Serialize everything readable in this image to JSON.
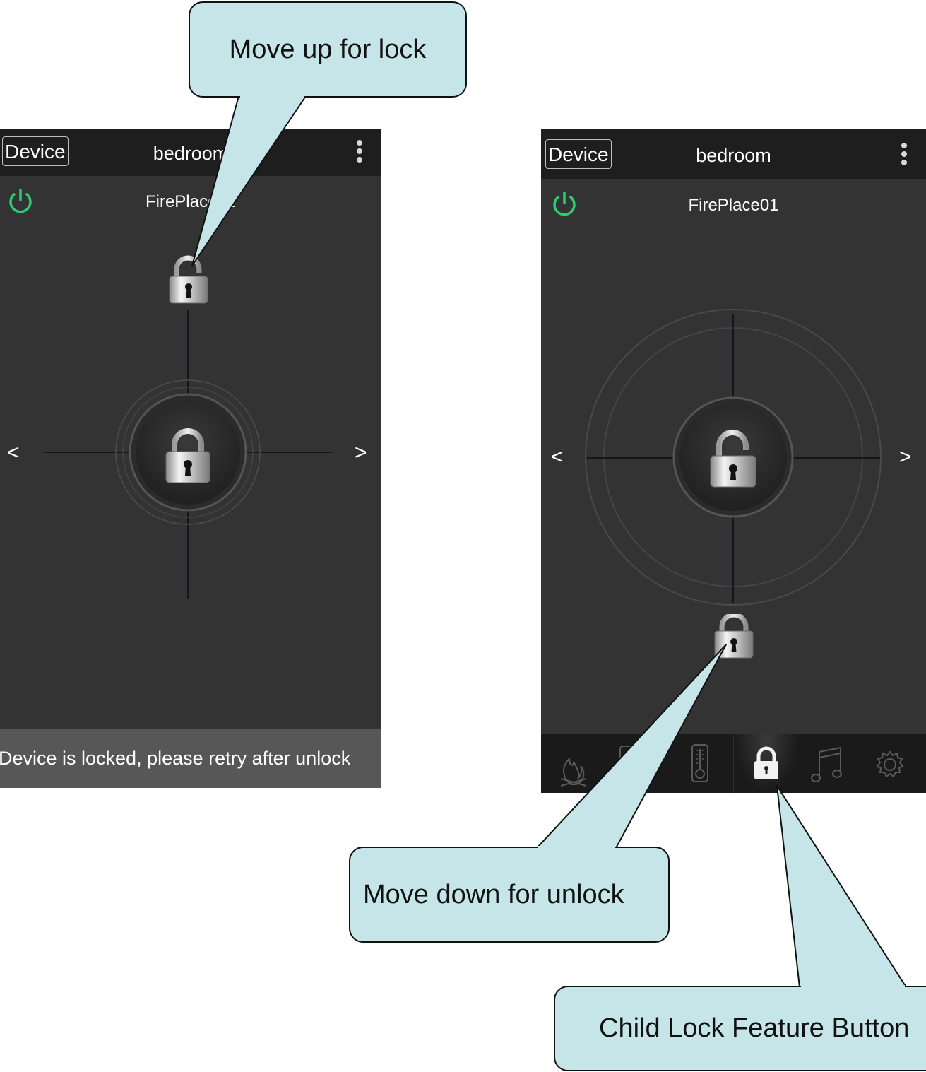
{
  "left_screen": {
    "header": {
      "device_button": "Device",
      "room": "bedroom"
    },
    "device_name": "FirePlace01",
    "prev_arrow": "<",
    "next_arrow": ">",
    "lock_state": "locked",
    "toast": "Device is locked, please retry after unlock"
  },
  "right_screen": {
    "header": {
      "device_button": "Device",
      "room": "bedroom"
    },
    "device_name": "FirePlace01",
    "prev_arrow": "<",
    "next_arrow": ">",
    "lock_state": "unlocked",
    "tabs": [
      {
        "icon": "flame-icon",
        "active": false
      },
      {
        "icon": "timer-icon",
        "active": false
      },
      {
        "icon": "thermometer-icon",
        "active": false
      },
      {
        "icon": "lock-icon",
        "active": true
      },
      {
        "icon": "music-note-icon",
        "active": false
      },
      {
        "icon": "gear-icon",
        "active": false
      }
    ]
  },
  "callouts": {
    "lock": "Move up for lock",
    "unlock": "Move down for unlock",
    "child_lock": "Child Lock Feature Button"
  },
  "colors": {
    "panel": "#333333",
    "header": "#1e1e1e",
    "power_green": "#2ecc71",
    "callout_fill": "#c5e5e8",
    "toast": "#575757"
  }
}
